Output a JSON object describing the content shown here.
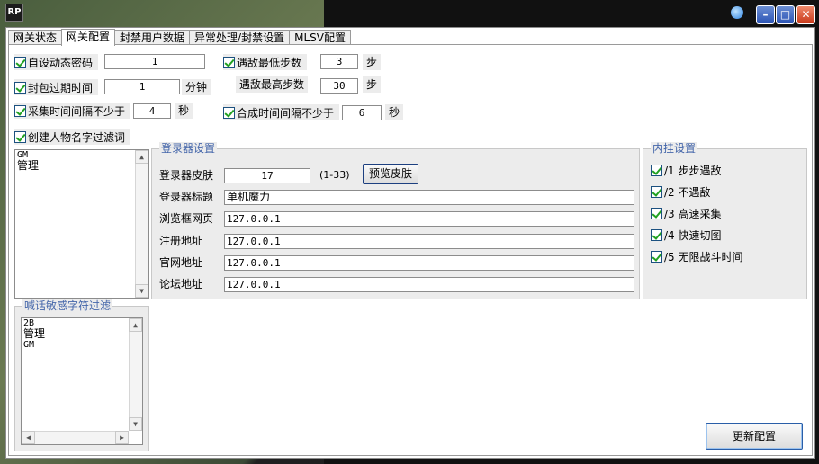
{
  "titlebar": {
    "app_icon_text": "RP"
  },
  "tabs": [
    {
      "label": "网关状态"
    },
    {
      "label": "网关配置"
    },
    {
      "label": "封禁用户数据"
    },
    {
      "label": "异常处理/封禁设置"
    },
    {
      "label": "MLSV配置"
    }
  ],
  "active_tab": "网关配置",
  "settings": {
    "dynamic_password": {
      "label": "自设动态密码",
      "value": "1",
      "checked": true
    },
    "min_steps": {
      "label": "遇敌最低步数",
      "value": "3",
      "unit": "步",
      "checked": true
    },
    "packet_expire": {
      "label": "封包过期时间",
      "value": "1",
      "unit": "分钟",
      "checked": true
    },
    "max_steps": {
      "label": "遇敌最高步数",
      "value": "30",
      "unit": "步"
    },
    "gather_interval": {
      "label": "采集时间间隔不少于",
      "value": "4",
      "unit": "秒",
      "checked": true
    },
    "compose_interval": {
      "label": "合成时间间隔不少于",
      "value": "6",
      "unit": "秒",
      "checked": true
    },
    "name_filter": {
      "label": "创建人物名字过滤词",
      "checked": true,
      "items": [
        "GM",
        "管理"
      ]
    }
  },
  "chat_filter": {
    "title": "喊话敏感字符过滤",
    "items": [
      "2B",
      "管理",
      "GM"
    ]
  },
  "launcher": {
    "title": "登录器设置",
    "skin_label": "登录器皮肤",
    "skin_value": "17",
    "skin_range": "(1-33)",
    "preview_button": "预览皮肤",
    "fields": [
      {
        "label": "登录器标题",
        "value": "单机魔力"
      },
      {
        "label": "浏览框网页",
        "value": "127.0.0.1"
      },
      {
        "label": "注册地址",
        "value": "127.0.0.1"
      },
      {
        "label": "官网地址",
        "value": "127.0.0.1"
      },
      {
        "label": "论坛地址",
        "value": "127.0.0.1"
      }
    ]
  },
  "plugin": {
    "title": "内挂设置",
    "items": [
      {
        "label": "/1 步步遇敌",
        "checked": true
      },
      {
        "label": "/2 不遇敌",
        "checked": true
      },
      {
        "label": "/3 高速采集",
        "checked": true
      },
      {
        "label": "/4 快速切图",
        "checked": true
      },
      {
        "label": "/5 无限战斗时间",
        "checked": true
      }
    ]
  },
  "update_button": "更新配置",
  "icons": {
    "minimize": "minimize-icon",
    "maximize": "maximize-icon",
    "close": "close-icon",
    "check": "check-icon",
    "scroll_up": "arrow-up-icon",
    "scroll_down": "arrow-down-icon",
    "scroll_left": "arrow-left-icon",
    "scroll_right": "arrow-right-icon"
  },
  "colors": {
    "group_title": "#4466aa",
    "check": "#21a121",
    "close": "#c8391a"
  }
}
